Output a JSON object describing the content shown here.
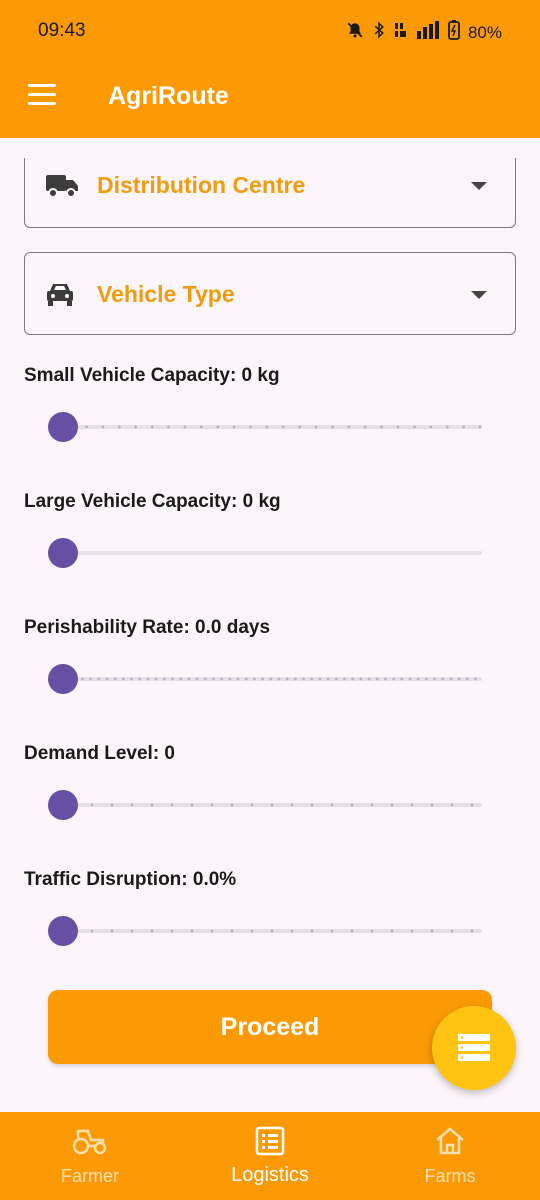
{
  "status": {
    "time": "09:43",
    "battery": "80%"
  },
  "app": {
    "title": "AgriRoute"
  },
  "dropdowns": {
    "distribution": {
      "label": "Distribution Centre",
      "icon": "truck-icon"
    },
    "vehicle": {
      "label": "Vehicle Type",
      "icon": "car-icon"
    }
  },
  "sliders": [
    {
      "label": "Small Vehicle Capacity: 0 kg",
      "value": 0
    },
    {
      "label": "Large Vehicle Capacity: 0 kg",
      "value": 0
    },
    {
      "label": "Perishability Rate: 0.0 days",
      "value": 0
    },
    {
      "label": "Demand Level: 0",
      "value": 0
    },
    {
      "label": "Traffic Disruption: 0.0%",
      "value": 0
    }
  ],
  "proceed_label": "Proceed",
  "fab": {
    "icon": "list-icon"
  },
  "nav": [
    {
      "label": "Farmer",
      "icon": "tractor-icon",
      "active": false
    },
    {
      "label": "Logistics",
      "icon": "list-icon",
      "active": true
    },
    {
      "label": "Farms",
      "icon": "home-icon",
      "active": false
    }
  ],
  "colors": {
    "accent": "#fb9a05",
    "slider": "#6750a4",
    "fab": "#ffc412",
    "label_accent": "#f29b0c"
  }
}
